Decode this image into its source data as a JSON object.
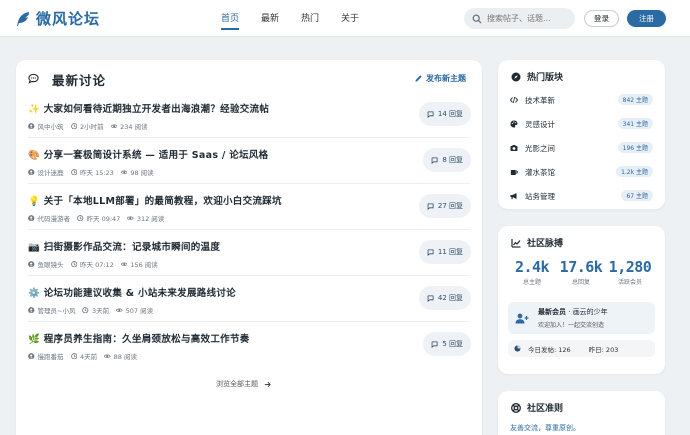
{
  "header": {
    "logo_text": "微风论坛",
    "nav": [
      {
        "label": "首页",
        "active": true
      },
      {
        "label": "最新",
        "active": false
      },
      {
        "label": "热门",
        "active": false
      },
      {
        "label": "关于",
        "active": false
      }
    ],
    "search_placeholder": "搜索帖子、话题...",
    "login_label": "登录",
    "register_label": "注册"
  },
  "main": {
    "title": "最新讨论",
    "new_post_label": "发布新主题",
    "posts": [
      {
        "emoji": "✨",
        "title": "大家如何看待近期独立开发者出海浪潮？经验交流帖",
        "author": "风中小筑",
        "time": "2小时前",
        "views": "234 阅读",
        "replies": "14 回复"
      },
      {
        "emoji": "🎨",
        "title": "分享一套极简设计系统 — 适用于 Saas / 论坛风格",
        "author": "设计迷鹿",
        "time": "昨天 15:23",
        "views": "98 阅读",
        "replies": "8 回复"
      },
      {
        "emoji": "💡",
        "title": "关于「本地LLM部署」的最简教程，欢迎小白交流踩坑",
        "author": "代码漫游者",
        "time": "昨天 09:47",
        "views": "312 阅读",
        "replies": "27 回复"
      },
      {
        "emoji": "📷",
        "title": "扫街摄影作品交流：记录城市瞬间的温度",
        "author": "鱼眼镜头",
        "time": "昨天 07:12",
        "views": "156 阅读",
        "replies": "11 回复"
      },
      {
        "emoji": "⚙️",
        "title": "论坛功能建议收集 & 小站未来发展路线讨论",
        "author": "管理员~小风",
        "time": "3天前",
        "views": "507 阅读",
        "replies": "42 回复"
      },
      {
        "emoji": "🌿",
        "title": "程序员养生指南：久坐肩颈放松与高效工作节奏",
        "author": "慢跑番茄",
        "time": "4天前",
        "views": "88 阅读",
        "replies": "5 回复"
      }
    ],
    "all_topics_label": "浏览全部主题"
  },
  "hot_boards": {
    "title": "热门版块",
    "items": [
      {
        "icon": "code-icon",
        "name": "技术革新",
        "count": "842 主题"
      },
      {
        "icon": "palette-icon",
        "name": "灵感设计",
        "count": "341 主题"
      },
      {
        "icon": "camera-icon",
        "name": "光影之间",
        "count": "196 主题"
      },
      {
        "icon": "mug-icon",
        "name": "灌水茶馆",
        "count": "1.2k 主题"
      },
      {
        "icon": "megaphone-icon",
        "name": "站务管理",
        "count": "67 主题"
      }
    ]
  },
  "pulse": {
    "title": "社区脉搏",
    "stats": [
      {
        "value": "2.4k",
        "label": "总主题"
      },
      {
        "value": "17.6k",
        "label": "总回复"
      },
      {
        "value": "1,280",
        "label": "活跃会员"
      }
    ],
    "newest_member_label": "最新会员",
    "newest_member_name": "画云的少年",
    "welcome": "欢迎加入！一起交流创造",
    "today_posts": "今日发帖: 126",
    "yesterday": "昨日: 203"
  },
  "rules": {
    "title": "社区准则",
    "text": "友善交流，尊重原创。"
  },
  "colors": {
    "accent": "#2b6aa3",
    "background": "#eef1f4"
  }
}
